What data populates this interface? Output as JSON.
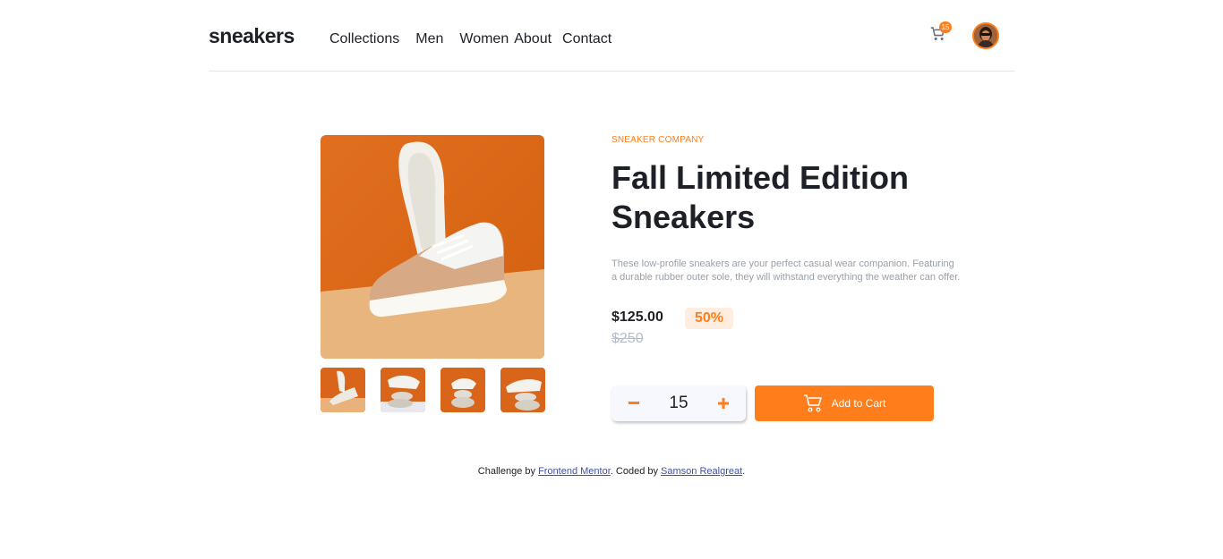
{
  "header": {
    "logo": "sneakers",
    "nav": [
      "Collections",
      "Men",
      "Women",
      "About",
      "Contact"
    ],
    "cart_count": "15"
  },
  "product": {
    "company": "SNEAKER COMPANY",
    "title": "Fall Limited Edition Sneakers",
    "description": "These low-profile sneakers are your perfect casual wear companion. Featuring a durable rubber outer sole, they will withstand everything the weather can offer.",
    "price": "$125.00",
    "discount": "50%",
    "old_price": "$250",
    "quantity": "15",
    "add_label": "Add to Cart"
  },
  "footer": {
    "prefix": "Challenge by ",
    "link1": "Frontend Mentor",
    "middle": ". Coded by ",
    "link2": "Samson Realgreat",
    "suffix": "."
  },
  "colors": {
    "accent": "#ff7d1a",
    "dark": "#1d2026",
    "muted": "#9aa0a8"
  }
}
